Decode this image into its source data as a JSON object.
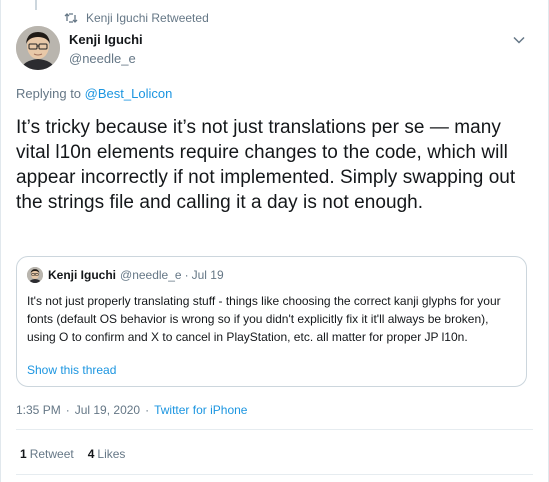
{
  "retweet_context": {
    "icon": "retweet-icon",
    "label": "Kenji Iguchi Retweeted"
  },
  "author": {
    "name": "Kenji Iguchi",
    "handle": "@needle_e",
    "avatar": "avatar"
  },
  "replying": {
    "prefix": "Replying to",
    "mention": "@Best_Lolicon"
  },
  "tweet": {
    "text": "It’s tricky because it’s not just translations per se — many vital l10n elements require changes to the code, which will appear incorrectly if not implemented. Simply swapping out the strings file and calling it a day is not enough."
  },
  "quoted": {
    "name": "Kenji Iguchi",
    "handle": "@needle_e",
    "separator": "·",
    "date": "Jul 19",
    "text": "It's not just properly translating stuff - things like choosing the correct kanji glyphs for your fonts (default OS behavior is wrong so if you didn't explicitly fix it it'll always be broken), using O to confirm and X to cancel in PlayStation, etc. all matter for proper JP l10n.",
    "show_thread": "Show this thread"
  },
  "meta": {
    "time": "1:35 PM",
    "separator": "·",
    "date": "Jul 19, 2020",
    "separator2": "·",
    "source": "Twitter for iPhone"
  },
  "stats": {
    "retweets_count": "1",
    "retweets_label": "Retweet",
    "likes_count": "4",
    "likes_label": "Likes"
  },
  "colors": {
    "link": "#1b95e0",
    "secondary_text": "#657786",
    "primary_text": "#14171a",
    "border": "#ccd6dd"
  }
}
